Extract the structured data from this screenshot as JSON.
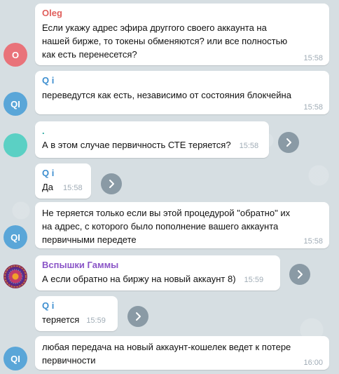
{
  "messages": [
    {
      "sender": "Oleg",
      "sender_color": "#e0605d",
      "avatar_text": "O",
      "avatar_color": "#e9737a",
      "text": "Если укажу адрес эфира друггого своего аккаунта на нашей бирже, то токены обменяются? или все полностью как есть перенесется?",
      "time": "15:58"
    },
    {
      "sender": "Q i",
      "sender_color": "#3e8fd0",
      "avatar_text": "QI",
      "avatar_color": "#5aa6d8",
      "text": "переведутся как есть, независимо от состояния блокчейна",
      "time": "15:58"
    },
    {
      "sender": ".",
      "sender_color": "#2aa9a0",
      "avatar_text": "",
      "avatar_color": "#5bd0c4",
      "text": "А в этом случае первичность СТЕ теряется?",
      "time": "15:58",
      "forward_icon": "share-arrow-icon"
    },
    {
      "sender": "Q i",
      "sender_color": "#3e8fd0",
      "text": "Да",
      "time": "15:58",
      "forward_icon": "share-arrow-icon"
    },
    {
      "sender": "",
      "avatar_text": "QI",
      "avatar_color": "#5aa6d8",
      "text": "Не теряется только если вы этой процедурой \"обратно\" их на адрес, с которого было пополнение вашего аккаунта первичными передете",
      "time": "15:58"
    },
    {
      "sender": "Вспышки Гаммы",
      "sender_color": "#8a55c7",
      "avatar_text": "",
      "avatar_color": "#8b2f58",
      "text": "А если обратно на биржу на новый аккаунт 8)",
      "time": "15:59",
      "forward_icon": "share-arrow-icon"
    },
    {
      "sender": "Q i",
      "sender_color": "#3e8fd0",
      "text": "теряется",
      "time": "15:59",
      "forward_icon": "share-arrow-icon"
    },
    {
      "sender": "",
      "avatar_text": "QI",
      "avatar_color": "#5aa6d8",
      "text": "любая передача на новый аккаунт-кошелек ведет к потере первичности",
      "time": "16:00"
    }
  ]
}
